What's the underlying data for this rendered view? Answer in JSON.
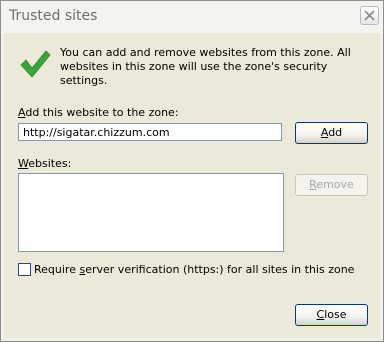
{
  "window": {
    "title": "Trusted sites"
  },
  "intro": {
    "text": "You can add and remove websites from this zone. All websites in this zone will use the zone's security settings."
  },
  "add_site": {
    "label_accel": "A",
    "label_rest": "dd this website to the zone:",
    "input_value": "http://sigatar.chizzum.com",
    "add_button_accel": "A",
    "add_button_rest": "dd"
  },
  "websites": {
    "label_accel": "W",
    "label_rest": "ebsites:",
    "items": [],
    "remove_button_accel": "R",
    "remove_button_rest": "emove"
  },
  "verification": {
    "label_before": "Require ",
    "label_accel": "s",
    "label_after": "erver verification (https:) for all sites in this zone",
    "checked": false
  },
  "footer": {
    "close_button_accel": "C",
    "close_button_rest": "lose"
  },
  "colors": {
    "check_green": "#3aa639",
    "panel_bg": "#ece9d8"
  }
}
